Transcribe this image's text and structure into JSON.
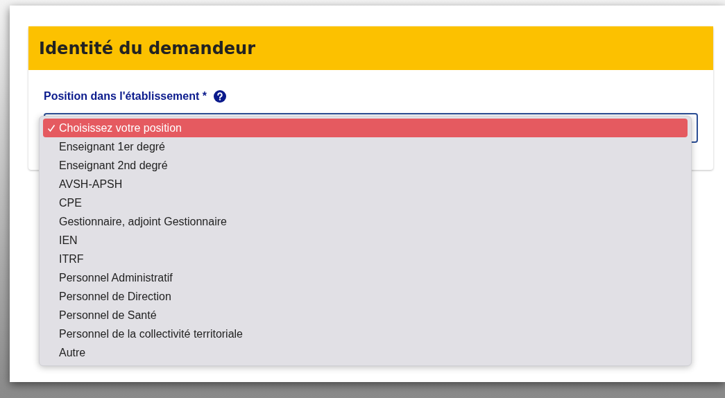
{
  "card": {
    "title": "Identité du demandeur"
  },
  "field": {
    "label": "Position dans l'établissement *"
  },
  "dropdown": {
    "options": [
      {
        "label": "Choisissez votre position",
        "selected": true
      },
      {
        "label": "Enseignant 1er degré",
        "selected": false
      },
      {
        "label": "Enseignant 2nd degré",
        "selected": false
      },
      {
        "label": "AVSH-APSH",
        "selected": false
      },
      {
        "label": "CPE",
        "selected": false
      },
      {
        "label": "Gestionnaire, adjoint Gestionnaire",
        "selected": false
      },
      {
        "label": "IEN",
        "selected": false
      },
      {
        "label": "ITRF",
        "selected": false
      },
      {
        "label": "Personnel Administratif",
        "selected": false
      },
      {
        "label": "Personnel de Direction",
        "selected": false
      },
      {
        "label": "Personnel de Santé",
        "selected": false
      },
      {
        "label": "Personnel de la collectivité territoriale",
        "selected": false
      },
      {
        "label": "Autre",
        "selected": false
      }
    ]
  }
}
